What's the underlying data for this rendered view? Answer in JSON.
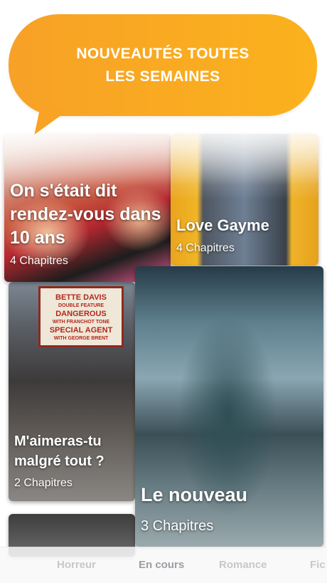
{
  "banner": {
    "text": "NOUVEAUTÉS TOUTES\nLES SEMAINES"
  },
  "stories": [
    {
      "title": "On s'était dit rendez-vous dans 10 ans",
      "chapters": "4 Chapitres"
    },
    {
      "title": "Love Gayme",
      "chapters": "4 Chapitres"
    },
    {
      "title": "M'aimeras-tu malgré tout ?",
      "chapters": "2 Chapitres"
    },
    {
      "title": "Le nouveau",
      "chapters": "3 Chapitres"
    }
  ],
  "marquee": {
    "line1": "BETTE DAVIS",
    "line2": "DOUBLE FEATURE",
    "line3": "DANGEROUS",
    "line4": "WITH FRANCHOT TONE",
    "line5": "SPECIAL AGENT",
    "line6": "WITH GEORGE BRENT"
  },
  "tabs": [
    {
      "label": "Horreur",
      "active": false
    },
    {
      "label": "En cours",
      "active": true
    },
    {
      "label": "Romance",
      "active": false
    },
    {
      "label": "Fic",
      "active": false
    }
  ],
  "colors": {
    "banner_start": "#f7a126",
    "banner_end": "#fbb21d"
  }
}
